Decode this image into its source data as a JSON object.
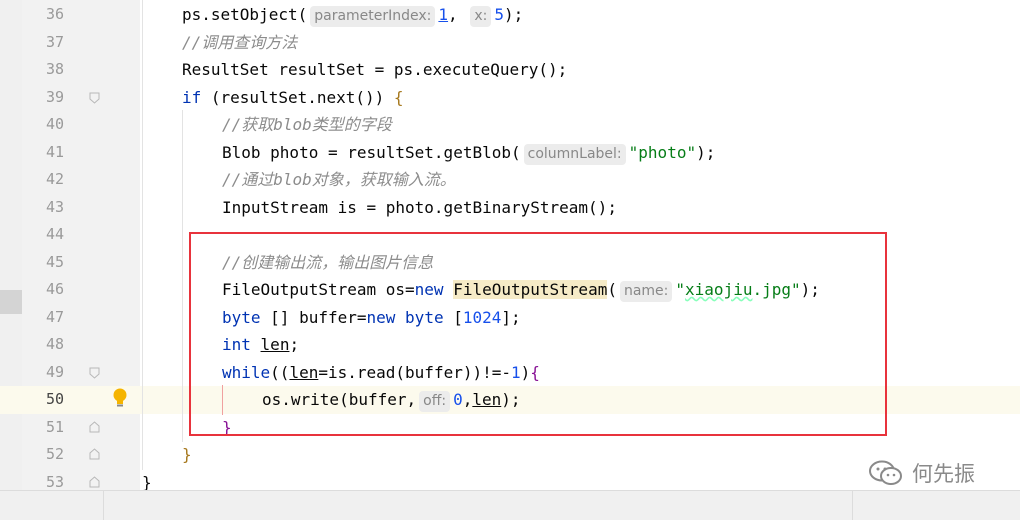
{
  "editor": {
    "current_line": "50",
    "lines": [
      {
        "no": "36",
        "tokens": [
          {
            "t": "ps.setObject("
          },
          {
            "t": "parameterIndex:",
            "c": "hint"
          },
          {
            "t": "1",
            "c": "num ul"
          },
          {
            "t": ", "
          },
          {
            "t": "x:",
            "c": "hint"
          },
          {
            "t": "5",
            "c": "num"
          },
          {
            "t": ");"
          }
        ]
      },
      {
        "no": "37",
        "tokens": [
          {
            "t": "//调用查询方法",
            "c": "cm"
          }
        ]
      },
      {
        "no": "38",
        "tokens": [
          {
            "t": "ResultSet resultSet = ps.executeQuery();"
          }
        ]
      },
      {
        "no": "39",
        "tokens": [
          {
            "t": "if",
            "c": "kw"
          },
          {
            "t": " (resultSet.next()) "
          },
          {
            "t": "{",
            "c": "paren-y"
          }
        ]
      },
      {
        "no": "40",
        "tokens": [
          {
            "t": "//获取blob类型的字段",
            "c": "cm"
          }
        ]
      },
      {
        "no": "41",
        "tokens": [
          {
            "t": "Blob photo = resultSet.getBlob("
          },
          {
            "t": "columnLabel:",
            "c": "hint"
          },
          {
            "t": "\"photo\"",
            "c": "str"
          },
          {
            "t": ");"
          }
        ]
      },
      {
        "no": "42",
        "tokens": [
          {
            "t": "//通过blob对象，获取输入流。",
            "c": "cm"
          }
        ]
      },
      {
        "no": "43",
        "tokens": [
          {
            "t": "InputStream is = photo.getBinaryStream();"
          }
        ]
      },
      {
        "no": "44",
        "tokens": []
      },
      {
        "no": "45",
        "tokens": [
          {
            "t": "//创建输出流，输出图片信息",
            "c": "cm"
          }
        ]
      },
      {
        "no": "46",
        "tokens": [
          {
            "t": "FileOutputStream os="
          },
          {
            "t": "new",
            "c": "kw"
          },
          {
            "t": " "
          },
          {
            "t": "FileOutputStream",
            "c": "hl"
          },
          {
            "t": "("
          },
          {
            "t": "name:",
            "c": "hint"
          },
          {
            "t": "\"",
            "c": "str"
          },
          {
            "t": "xiaojiu",
            "c": "str typo"
          },
          {
            "t": ".jpg\"",
            "c": "str"
          },
          {
            "t": ");"
          }
        ]
      },
      {
        "no": "47",
        "tokens": [
          {
            "t": "byte",
            "c": "kw"
          },
          {
            "t": " [] buffer="
          },
          {
            "t": "new",
            "c": "kw"
          },
          {
            "t": " "
          },
          {
            "t": "byte",
            "c": "kw"
          },
          {
            "t": " ["
          },
          {
            "t": "1024",
            "c": "num"
          },
          {
            "t": "];"
          }
        ]
      },
      {
        "no": "48",
        "tokens": [
          {
            "t": "int",
            "c": "kw"
          },
          {
            "t": " "
          },
          {
            "t": "len",
            "c": "ul"
          },
          {
            "t": ";"
          }
        ]
      },
      {
        "no": "49",
        "tokens": [
          {
            "t": "while",
            "c": "kw"
          },
          {
            "t": "(("
          },
          {
            "t": "len",
            "c": "ul"
          },
          {
            "t": "=is.read(buffer))!=-"
          },
          {
            "t": "1",
            "c": "num"
          },
          {
            "t": ")"
          },
          {
            "t": "{",
            "c": "paren-p"
          }
        ]
      },
      {
        "no": "50",
        "tokens": [
          {
            "t": "os.write(buffer,"
          },
          {
            "t": "off:",
            "c": "hint"
          },
          {
            "t": "0",
            "c": "num"
          },
          {
            "t": ","
          },
          {
            "t": "len",
            "c": "ul"
          },
          {
            "t": ");"
          }
        ]
      },
      {
        "no": "51",
        "tokens": [
          {
            "t": "}",
            "c": "paren-p"
          }
        ]
      },
      {
        "no": "52",
        "tokens": [
          {
            "t": "}",
            "c": "paren-y"
          }
        ]
      },
      {
        "no": "53",
        "tokens": [
          {
            "t": "}"
          }
        ]
      }
    ]
  },
  "watermark": {
    "text": "何先振",
    "icon": "wechat-icon"
  },
  "icons": {
    "bulb": "lightbulb-icon",
    "fold": "fold-marker-icon"
  },
  "colors": {
    "keyword": "#0033b3",
    "comment": "#8c8c8c",
    "number": "#1750eb",
    "string": "#067d17",
    "highlight_box": "#e8333c"
  }
}
